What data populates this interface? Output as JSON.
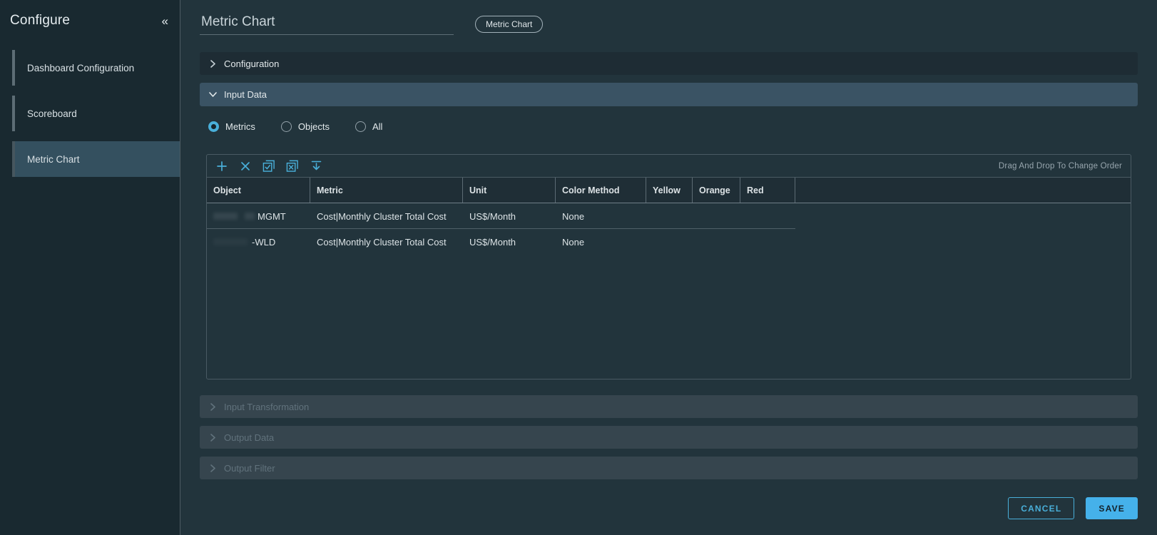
{
  "colors": {
    "accent": "#49afd9",
    "save_button": "#45b1ea",
    "sidebar_bg": "#192930",
    "main_bg": "#22343c",
    "expanded_header_bg": "#3a5364"
  },
  "sidebar": {
    "title": "Configure",
    "collapse_icon": "«",
    "items": [
      {
        "label": "Dashboard Configuration",
        "selected": false
      },
      {
        "label": "Scoreboard",
        "selected": false
      },
      {
        "label": "Metric Chart",
        "selected": true
      }
    ]
  },
  "header": {
    "title_value": "Metric Chart",
    "type_badge": "Metric Chart"
  },
  "sections": {
    "configuration": {
      "label": "Configuration",
      "expanded": false,
      "disabled": false
    },
    "input_data": {
      "label": "Input Data",
      "expanded": true,
      "disabled": false
    },
    "input_transformation": {
      "label": "Input Transformation",
      "expanded": false,
      "disabled": true
    },
    "output_data": {
      "label": "Output Data",
      "expanded": false,
      "disabled": true
    },
    "output_filter": {
      "label": "Output Filter",
      "expanded": false,
      "disabled": true
    }
  },
  "input_data": {
    "radios": [
      {
        "label": "Metrics",
        "selected": true
      },
      {
        "label": "Objects",
        "selected": false
      },
      {
        "label": "All",
        "selected": false
      }
    ],
    "toolbar": {
      "icon_names": [
        "add-icon",
        "remove-icon",
        "select-all-icon",
        "deselect-all-icon",
        "move-to-bottom-icon"
      ],
      "drag_hint": "Drag And Drop To Change Order"
    },
    "table": {
      "columns": [
        "Object",
        "Metric",
        "Unit",
        "Color Method",
        "Yellow",
        "Orange",
        "Red"
      ],
      "rows": [
        {
          "object": "MGMT",
          "object_prefix_redacted": true,
          "metric": "Cost|Monthly Cluster Total Cost",
          "unit": "US$/Month",
          "color_method": "None",
          "yellow": "",
          "orange": "",
          "red": ""
        },
        {
          "object": "-WLD",
          "object_prefix_redacted": true,
          "metric": "Cost|Monthly Cluster Total Cost",
          "unit": "US$/Month",
          "color_method": "None",
          "yellow": "",
          "orange": "",
          "red": ""
        }
      ]
    }
  },
  "footer": {
    "cancel_label": "CANCEL",
    "save_label": "SAVE"
  }
}
